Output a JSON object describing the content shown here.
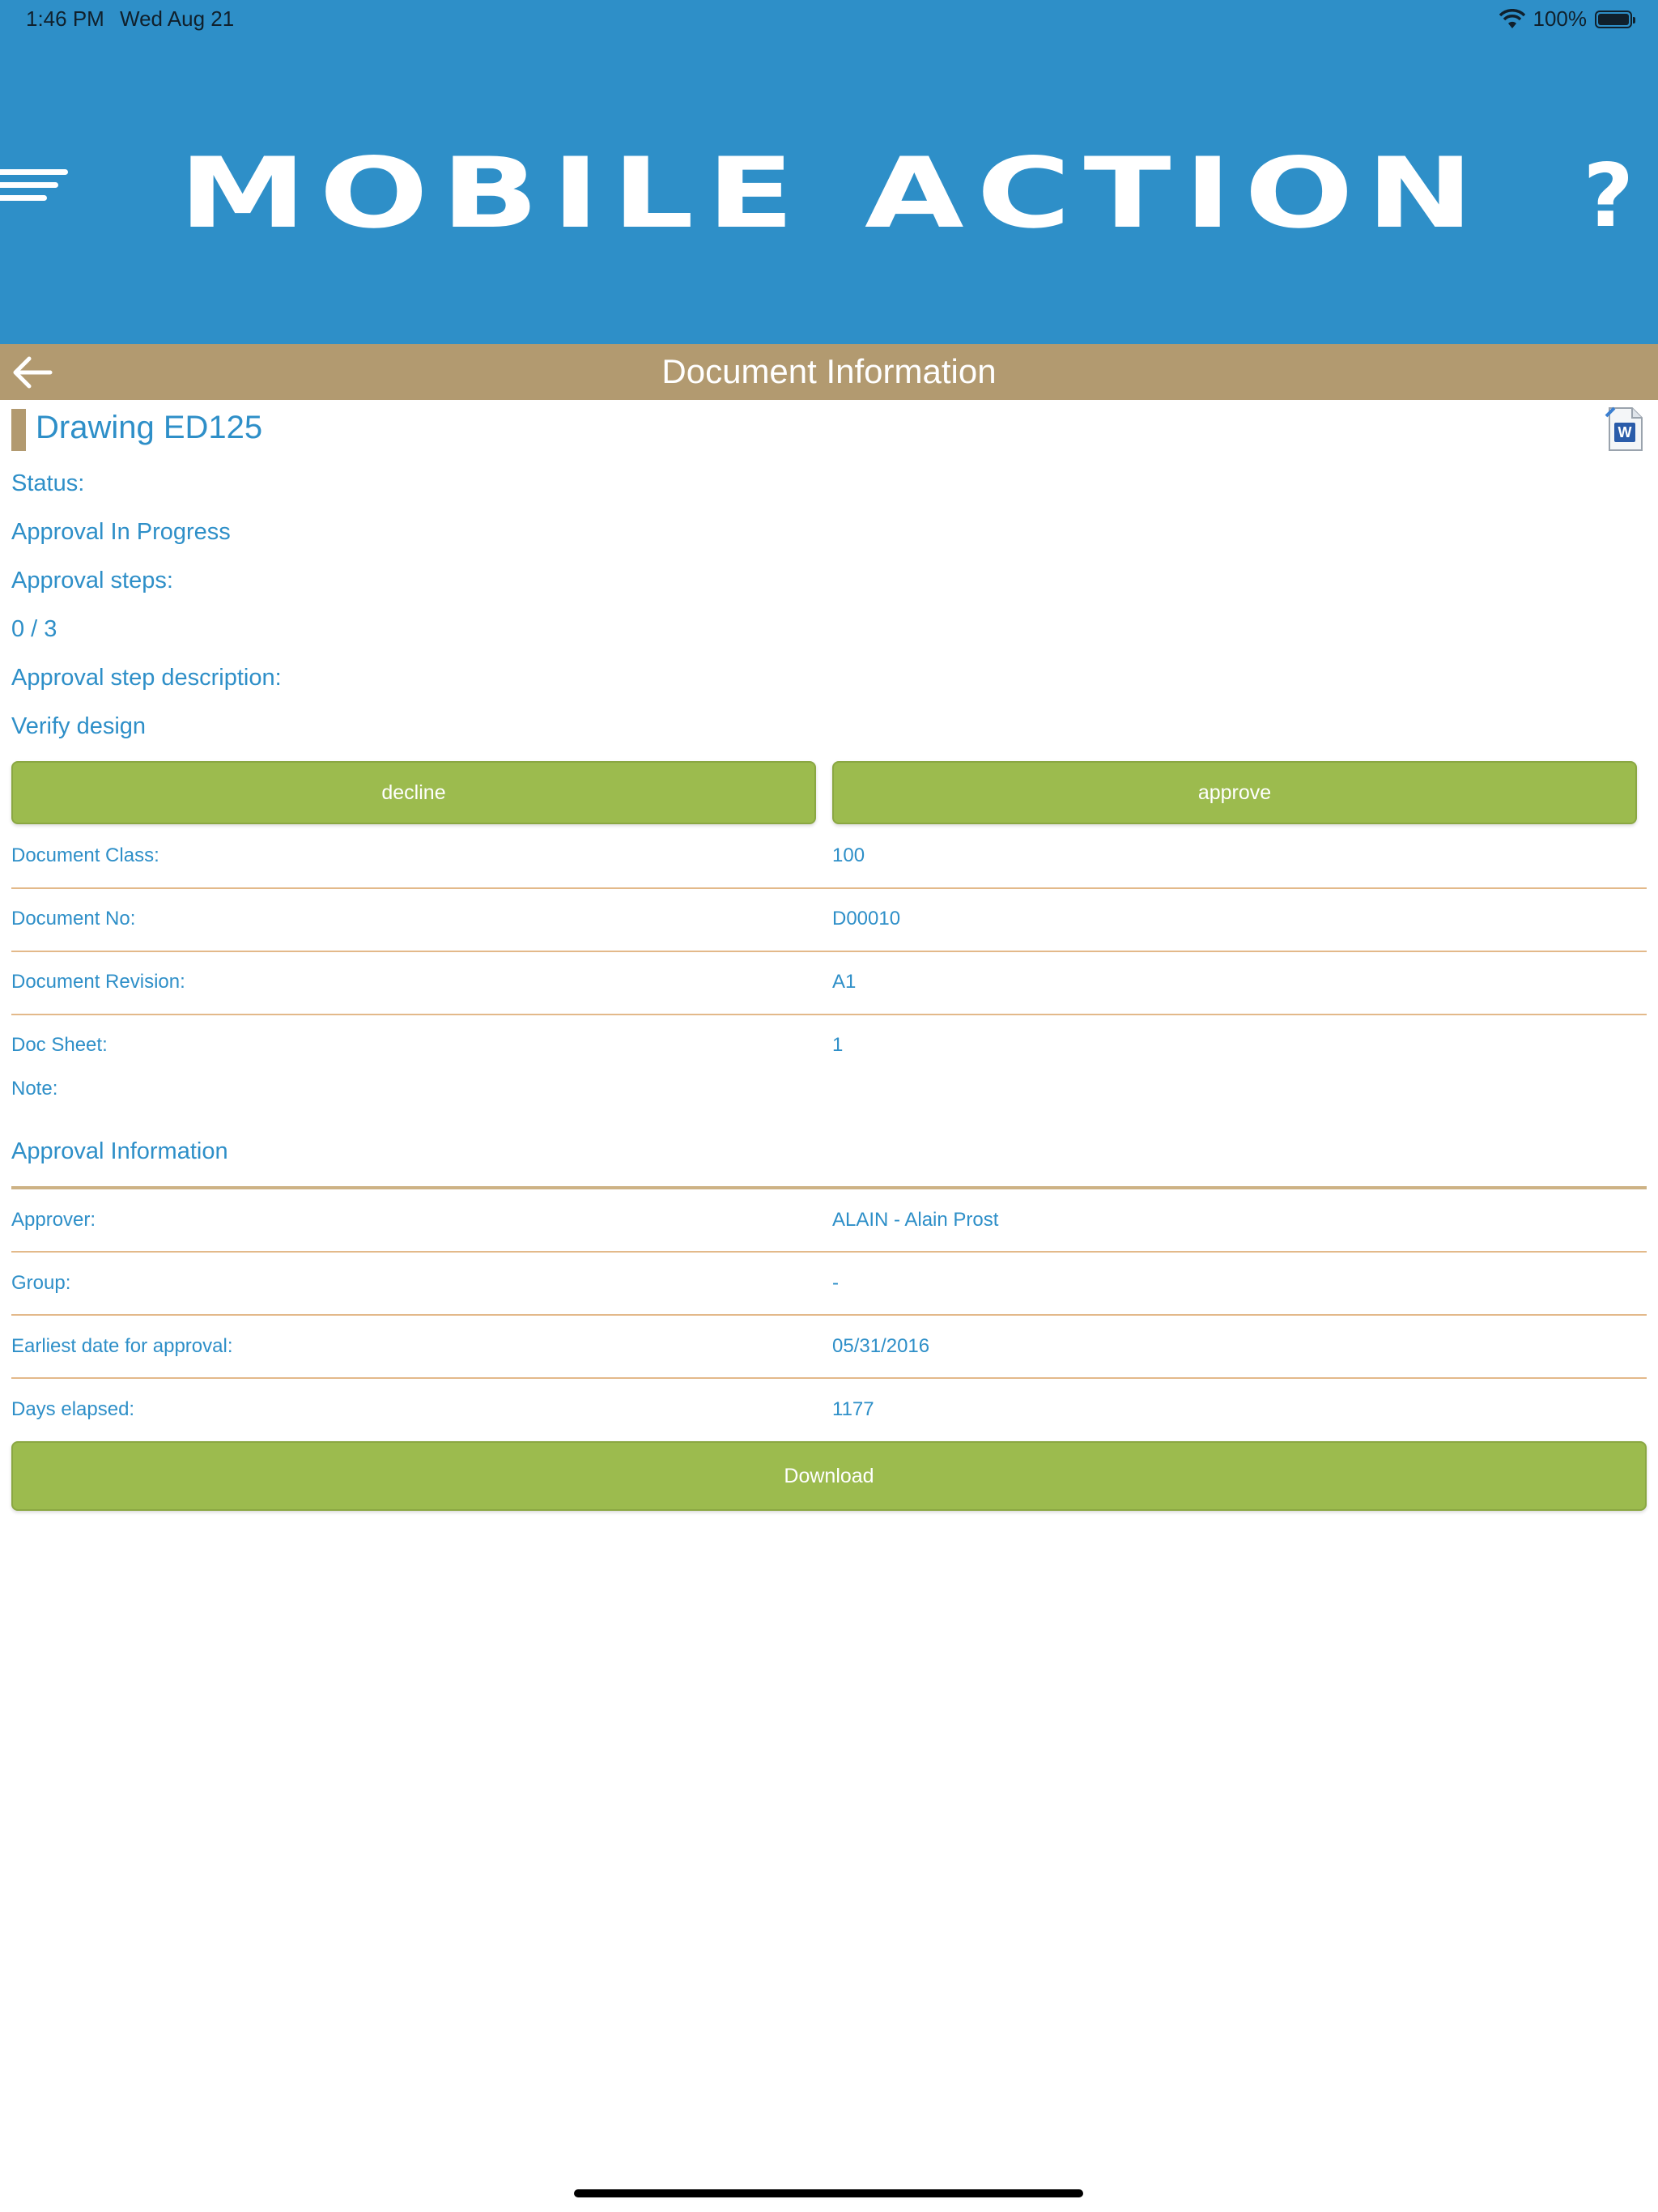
{
  "status_bar": {
    "time": "1:46 PM",
    "date": "Wed Aug 21",
    "battery": "100%"
  },
  "header": {
    "app_title": "MOBILE ACTION",
    "help_symbol": "?"
  },
  "subheader": {
    "title": "Document Information"
  },
  "document": {
    "title": "Drawing ED125",
    "status_label": "Status:",
    "status_value": "Approval In Progress",
    "steps_label": "Approval steps:",
    "steps_value": "0 / 3",
    "step_desc_label": "Approval step description:",
    "step_desc_value": "Verify design"
  },
  "actions": {
    "decline": "decline",
    "approve": "approve",
    "download": "Download"
  },
  "fields": [
    {
      "label": "Document Class:",
      "value": "100"
    },
    {
      "label": "Document No:",
      "value": "D00010"
    },
    {
      "label": "Document Revision:",
      "value": "A1"
    },
    {
      "label": "Doc Sheet:",
      "value": "1"
    }
  ],
  "note_label": "Note:",
  "approval": {
    "section_title": "Approval Information",
    "rows": [
      {
        "label": "Approver:",
        "value": "ALAIN - Alain Prost"
      },
      {
        "label": "Group:",
        "value": "-"
      },
      {
        "label": "Earliest date for approval:",
        "value": "05/31/2016"
      },
      {
        "label": "Days elapsed:",
        "value": "1177"
      }
    ]
  },
  "colors": {
    "header_blue": "#2e8fc8",
    "tan": "#b29a70",
    "button_green": "#9cbb4e",
    "text_blue": "#2e8fc8",
    "divider": "#e3b98a"
  },
  "icons": {
    "menu": "hamburger-menu-icon",
    "help": "help-icon",
    "back": "back-arrow-icon",
    "doc": "word-document-icon",
    "wifi": "wifi-icon",
    "battery": "battery-icon"
  }
}
